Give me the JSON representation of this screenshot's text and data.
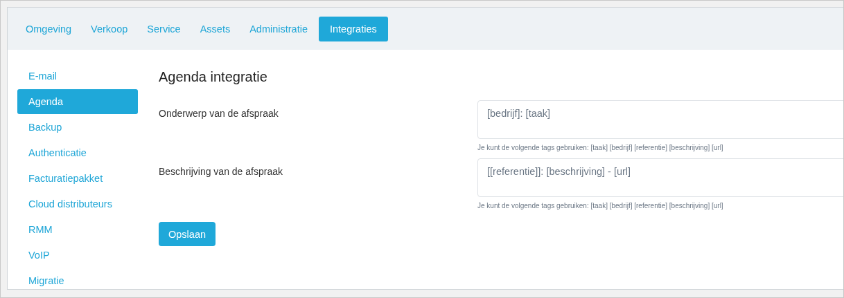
{
  "tabs": [
    {
      "label": "Omgeving",
      "selected": false
    },
    {
      "label": "Verkoop",
      "selected": false
    },
    {
      "label": "Service",
      "selected": false
    },
    {
      "label": "Assets",
      "selected": false
    },
    {
      "label": "Administratie",
      "selected": false
    },
    {
      "label": "Integraties",
      "selected": true
    }
  ],
  "sidebar": {
    "items": [
      {
        "label": "E-mail",
        "selected": false
      },
      {
        "label": "Agenda",
        "selected": true
      },
      {
        "label": "Backup",
        "selected": false
      },
      {
        "label": "Authenticatie",
        "selected": false
      },
      {
        "label": "Facturatiepakket",
        "selected": false
      },
      {
        "label": "Cloud distributeurs",
        "selected": false
      },
      {
        "label": "RMM",
        "selected": false
      },
      {
        "label": "VoIP",
        "selected": false
      },
      {
        "label": "Migratie",
        "selected": false
      }
    ]
  },
  "content": {
    "title": "Agenda integratie",
    "fields": [
      {
        "label": "Onderwerp van de afspraak",
        "value": "[bedrijf]: [taak]",
        "hint": "Je kunt de volgende tags gebruiken: [taak] [bedrijf] [referentie] [beschrijving] [url]"
      },
      {
        "label": "Beschrijving van de afspraak",
        "value": "[[referentie]]: [beschrijving] - [url]",
        "hint": "Je kunt de volgende tags gebruiken: [taak] [bedrijf] [referentie] [beschrijving] [url]"
      }
    ],
    "save_button": "Opslaan"
  }
}
